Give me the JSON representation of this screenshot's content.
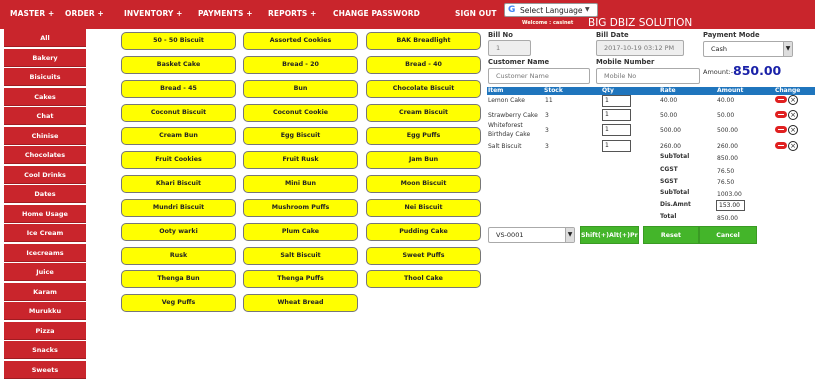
{
  "nav": {
    "items": [
      "MASTER +",
      "ORDER +",
      "INVENTORY +",
      "PAYMENTS +",
      "REPORTS +",
      "CHANGE PASSWORD",
      "SIGN OUT"
    ],
    "language_label": "Select Language",
    "welcome_label": "Welcome :",
    "welcome_user": "casinet",
    "brand": "BIG DBIZ SOLUTION",
    "nav_color": "#c9252c"
  },
  "sidebar": {
    "items": [
      "All",
      "Bakery",
      "Bisicuits",
      "Cakes",
      "Chat",
      "Chinise",
      "Chocolates",
      "Cool Drinks",
      "Dates",
      "Home Usage",
      "Ice Cream",
      "Icecreams",
      "Juice",
      "Karam",
      "Murukku",
      "Pizza",
      "Snacks",
      "Sweets"
    ]
  },
  "products": [
    "50 - 50 Biscuit",
    "Assorted Cookies",
    "BAK Breadlight",
    "Basket Cake",
    "Bread - 20",
    "Bread - 40",
    "Bread - 45",
    "Bun",
    "Chocolate Biscuit",
    "Coconut Biscuit",
    "Coconut Cookie",
    "Cream Biscuit",
    "Cream Bun",
    "Egg Biscuit",
    "Egg Puffs",
    "Fruit Cookies",
    "Fruit Rusk",
    "Jam Bun",
    "Khari Biscuit",
    "Mini Bun",
    "Moon Biscuit",
    "Mundri Biscuit",
    "Mushroom Puffs",
    "Nei Biscuit",
    "Ooty warki",
    "Plum Cake",
    "Pudding Cake",
    "Rusk",
    "Salt Biscuit",
    "Sweet Puffs",
    "Thenga Bun",
    "Thenga Puffs",
    "Thool Cake",
    "Veg Puffs",
    "Wheat Bread"
  ],
  "bill": {
    "bill_no_label": "Bill No",
    "bill_no": "1",
    "bill_date_label": "Bill Date",
    "bill_date": "2017-10-19 03:12 PM",
    "payment_mode_label": "Payment Mode",
    "payment_mode": "Cash",
    "customer_name_label": "Customer Name",
    "customer_name_placeholder": "Customer Name",
    "mobile_label": "Mobile Number",
    "mobile_placeholder": "Mobile No",
    "amount_label": "Amount:-",
    "amount_value": "850.00"
  },
  "table": {
    "headers": [
      "Item",
      "Stock",
      "Qty",
      "Rate",
      "Amount",
      "Change"
    ],
    "rows": [
      {
        "item": "Lemon Cake",
        "stock": "11",
        "qty": "1",
        "rate": "40.00",
        "amount": "40.00"
      },
      {
        "item": "Strawberry Cake",
        "stock": "3",
        "qty": "1",
        "rate": "50.00",
        "amount": "50.00"
      },
      {
        "item": "Whiteforest Birthday Cake",
        "item_line1": "Whiteforest",
        "item_line2": "Birthday Cake",
        "stock": "3",
        "qty": "1",
        "rate": "500.00",
        "amount": "500.00"
      },
      {
        "item": "Salt Biscuit",
        "stock": "3",
        "qty": "1",
        "rate": "260.00",
        "amount": "260.00"
      }
    ],
    "header_color": "#1f75bd"
  },
  "totals": {
    "subtotal_label": "SubTotal",
    "subtotal": "850.00",
    "cgst_label": "CGST",
    "cgst": "76.50",
    "sgst_label": "SGST",
    "sgst": "76.50",
    "subtotal2_label": "SubTotal",
    "subtotal2": "1003.00",
    "discount_label": "Dis.Amnt",
    "discount": "153.00",
    "total_label": "Total",
    "total": "850.00"
  },
  "actions": {
    "vs_select": "VS-0001",
    "print_label": "Shift(+)Alt(+)Print",
    "reset_label": "Reset",
    "cancel_label": "Cancel",
    "button_color": "#44b52a"
  }
}
